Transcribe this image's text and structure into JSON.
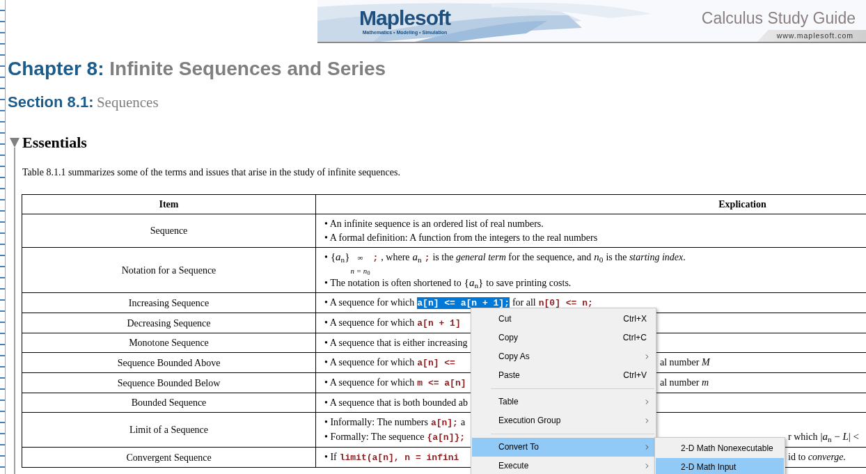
{
  "banner": {
    "logo": "Maplesoft",
    "tagline": "Mathematics • Modeling • Simulation",
    "title": "Calculus Study Guide",
    "url": "www.maplesoft.com"
  },
  "chapter": {
    "label": "Chapter 8:",
    "title": "Infinite Sequences and Series"
  },
  "section": {
    "label": "Section 8.1:",
    "title": "Sequences"
  },
  "group": {
    "title": "Essentials",
    "expanded": true
  },
  "intro": "Table 8.1.1 summarizes some of the terms and issues that arise in the study of infinite sequences.",
  "table": {
    "columns": [
      "Item",
      "Explication"
    ],
    "rows": [
      {
        "item": "Sequence",
        "lines": [
          {
            "segments": [
              {
                "kind": "text",
                "t": "• An infinite sequence is an ordered list of real numbers."
              }
            ]
          },
          {
            "segments": [
              {
                "kind": "text",
                "t": "• A formal definition: A function from the integers to the real numbers"
              }
            ]
          }
        ]
      },
      {
        "item": "Notation for a Sequence",
        "lines": [
          {
            "segments": [
              {
                "kind": "text",
                "t": "•"
              },
              {
                "kind": "math",
                "t": "{*a*$_{n}$}"
              },
              {
                "kind": "limits",
                "sub": "n = n",
                "sub_index": "0",
                "sup": "∞"
              },
              {
                "kind": "code",
                "t": ";",
                "selected": false
              },
              {
                "kind": "text",
                "t": ", where"
              },
              {
                "kind": "math",
                "t": "*a*$_{n}$"
              },
              {
                "kind": "code",
                "t": ";",
                "selected": false
              },
              {
                "kind": "text",
                "t": "is the *general term* for the sequence, and"
              },
              {
                "kind": "math",
                "t": "*n*$_{0}$"
              },
              {
                "kind": "text",
                "t": "is the *starting index*."
              }
            ]
          },
          {
            "segments": [
              {
                "kind": "text",
                "t": "• The notation is often shortened to"
              },
              {
                "kind": "math",
                "t": "{*a*$_{n}$}"
              },
              {
                "kind": "text",
                "t": "to save printing costs."
              }
            ]
          }
        ]
      },
      {
        "item": "Increasing Sequence",
        "menu": true,
        "lines": [
          {
            "segments": [
              {
                "kind": "text",
                "t": "• A sequence for which"
              },
              {
                "kind": "code",
                "t": "a[n] <= a[n + 1];",
                "selected": true
              },
              {
                "kind": "text",
                "t": "for all"
              },
              {
                "kind": "code",
                "t": "n[0] <= n;",
                "selected": false
              }
            ]
          }
        ]
      },
      {
        "item": "Decreasing Sequence",
        "lines": [
          {
            "segments": [
              {
                "kind": "text",
                "t": "• A sequence for which"
              },
              {
                "kind": "code",
                "t": "a[n + 1]",
                "selected": false
              }
            ]
          }
        ]
      },
      {
        "item": "Monotone Sequence",
        "lines": [
          {
            "segments": [
              {
                "kind": "text",
                "t": "• A sequence that is either increasing"
              }
            ]
          }
        ]
      },
      {
        "item": "Sequence Bounded Above",
        "lines": [
          {
            "segments": [
              {
                "kind": "text",
                "t": "• A sequence for which"
              },
              {
                "kind": "code",
                "t": "a[n] <=",
                "selected": false
              }
            ],
            "after_menu": [
              {
                "kind": "text",
                "t": "al number *M*"
              }
            ]
          }
        ]
      },
      {
        "item": "Sequence Bounded Below",
        "lines": [
          {
            "segments": [
              {
                "kind": "text",
                "t": "• A sequence for which"
              },
              {
                "kind": "code",
                "t": "m <= a[n]",
                "selected": false
              }
            ],
            "after_menu": [
              {
                "kind": "text",
                "t": "al number *m*"
              }
            ]
          }
        ]
      },
      {
        "item": "Bounded Sequence",
        "lines": [
          {
            "segments": [
              {
                "kind": "text",
                "t": "• A sequence that is both bounded ab"
              }
            ]
          }
        ]
      },
      {
        "item": "Limit of a Sequence",
        "lines": [
          {
            "segments": [
              {
                "kind": "text",
                "t": "• Informally: The numbers"
              },
              {
                "kind": "code",
                "t": "a[n];",
                "selected": false
              },
              {
                "kind": "text",
                "t": "a"
              }
            ]
          },
          {
            "segments": [
              {
                "kind": "text",
                "t": "• Formally: The sequence"
              },
              {
                "kind": "code",
                "t": "{a[n]};",
                "selected": false
              }
            ],
            "after_submenu": [
              {
                "kind": "text",
                "t": "r which"
              },
              {
                "kind": "math",
                "t": "|*a*$_{n}$ − *L*| <"
              }
            ]
          }
        ]
      },
      {
        "item": "Convergent Sequence",
        "lines": [
          {
            "segments": [
              {
                "kind": "text",
                "t": "• If"
              },
              {
                "kind": "code",
                "t": "limit(a[n], n = infini",
                "selected": false
              }
            ],
            "after_submenu": [
              {
                "kind": "text",
                "t": "id to *converge.*"
              }
            ]
          }
        ]
      }
    ]
  },
  "context_menu": {
    "items": [
      {
        "kind": "item",
        "label": "Cut",
        "shortcut": "Ctrl+X",
        "has_submenu": false,
        "selected": false
      },
      {
        "kind": "item",
        "label": "Copy",
        "shortcut": "Ctrl+C",
        "has_submenu": false,
        "selected": false
      },
      {
        "kind": "item",
        "label": "Copy As",
        "has_submenu": true,
        "selected": false
      },
      {
        "kind": "item",
        "label": "Paste",
        "shortcut": "Ctrl+V",
        "has_submenu": false,
        "selected": false
      },
      {
        "kind": "separator"
      },
      {
        "kind": "item",
        "label": "Table",
        "has_submenu": true,
        "selected": false
      },
      {
        "kind": "item",
        "label": "Execution Group",
        "has_submenu": true,
        "selected": false
      },
      {
        "kind": "separator"
      },
      {
        "kind": "item",
        "label": "Convert To",
        "has_submenu": true,
        "selected": true,
        "open": true
      },
      {
        "kind": "item",
        "label": "Execute",
        "has_submenu": true,
        "selected": false
      }
    ]
  },
  "submenu": {
    "items": [
      {
        "label": "2-D Math Nonexecutable",
        "selected": false
      },
      {
        "label": "2-D Math Input",
        "selected": true
      }
    ]
  }
}
